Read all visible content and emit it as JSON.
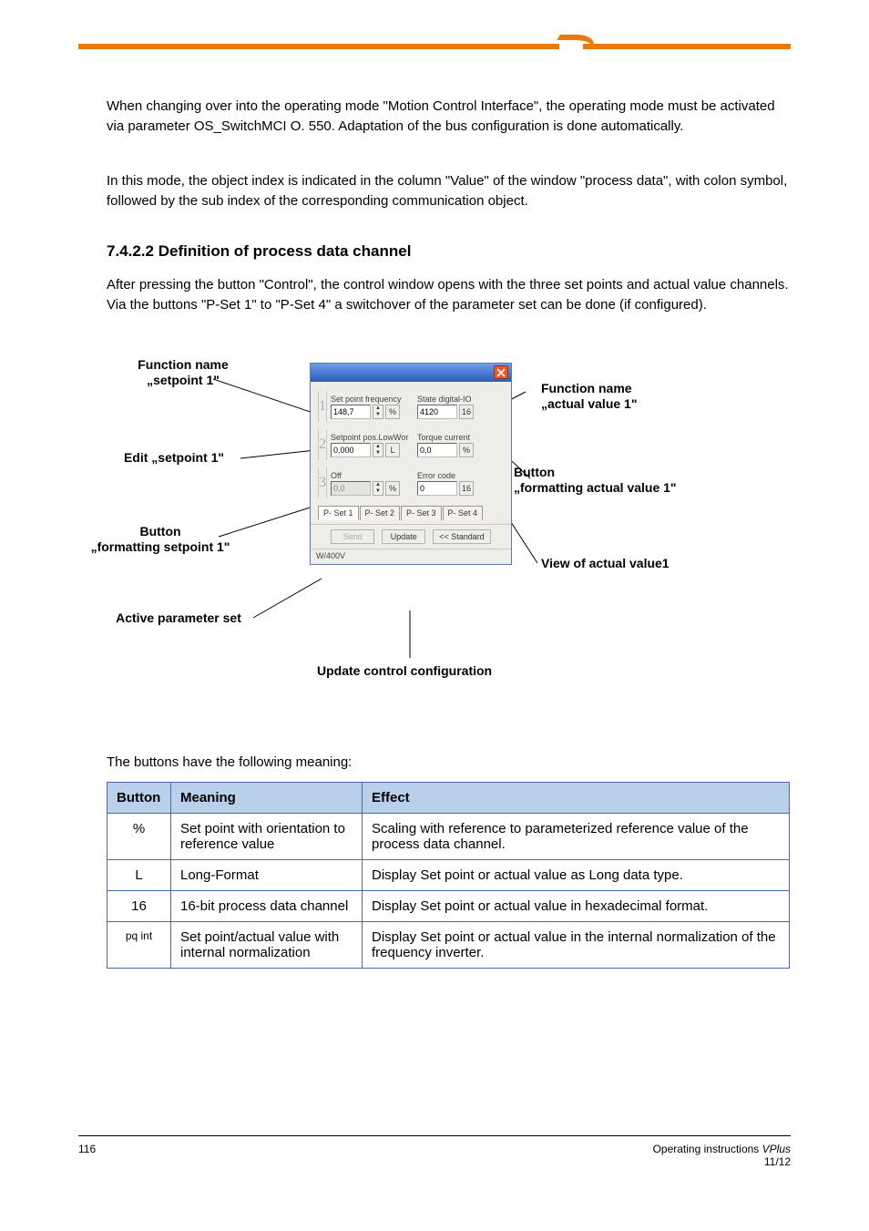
{
  "paragraphs": {
    "p1": "When changing over into the operating mode \"Motion Control Interface\", the operating mode must be activated via parameter OS_SwitchMCI O. 550. Adaptation of the bus configuration is done automatically.",
    "p2": "In this mode, the object index is indicated in the column \"Value\" of the window \"process data\", with colon symbol, followed by the sub index of the corresponding communication object.",
    "p3": "After pressing the button \"Control\", the control window opens with the three set points and actual value channels. Via the buttons \"P-Set 1\" to \"P-Set 4\" a switchover of the parameter set can be done (if configured)."
  },
  "headings": {
    "h1": "7.4.2.2 Definition of process data channel"
  },
  "diagram_labels": {
    "fn_setpoint": "Function name\n„setpoint 1\"",
    "edit_setpoint": "Edit „setpoint 1\"",
    "btn_fmt_setpoint": "Button\n„formatting setpoint 1\"",
    "active_pset": "Active parameter set",
    "fn_actual": "Function name\n„actual value 1\"",
    "btn_fmt_actual": "Button\n„formatting actual value 1\"",
    "view_actual": "View of actual value1",
    "update_caption": "Update control configuration"
  },
  "dialog": {
    "row1": {
      "sp_label": "Set point frequency",
      "sp_value": "148,7",
      "sp_unit": "%",
      "av_label": "State digital-IO",
      "av_value": "4120",
      "av_unit": "16"
    },
    "row2": {
      "sp_label": "Setpoint pos.LowWor",
      "sp_value": "0,000",
      "sp_unit": "L",
      "av_label": "Torque current",
      "av_value": "0,0",
      "av_unit": "%"
    },
    "row3": {
      "sp_label": "Off",
      "sp_value": "0,0",
      "sp_unit": "%",
      "av_label": "Error code",
      "av_value": "0",
      "av_unit": "16"
    },
    "tabs": {
      "t1": "P- Set 1",
      "t2": "P- Set 2",
      "t3": "P- Set 3",
      "t4": "P- Set 4"
    },
    "buttons": {
      "send": "Send",
      "update": "Update",
      "standard": "<< Standard"
    },
    "footer": "W/400V"
  },
  "table_intro": "The buttons have the following meaning:",
  "table": {
    "h1": "Button",
    "h2": "Meaning",
    "h3": "Effect",
    "r1": {
      "c1": "%",
      "c2": "Set point with orientation to reference value",
      "c3": "Scaling with reference to parameterized reference value of the process data channel."
    },
    "r2": {
      "c1": "L",
      "c2": "Long-Format",
      "c3": "Display Set point or actual value as Long data type."
    },
    "r3": {
      "c1": "16",
      "c2": "16-bit process data channel",
      "c3": "Display Set point or actual value in hexadecimal format."
    },
    "r4": {
      "c1": "pq int",
      "c2": "Set point/actual value with internal normalization",
      "c3": "Display Set point or actual value in the internal normalization of the frequency inverter."
    }
  },
  "footer": {
    "left": "116",
    "right_line1": "Operating instructions ",
    "right_em": "VPlus",
    "right_line2": "11/12"
  }
}
